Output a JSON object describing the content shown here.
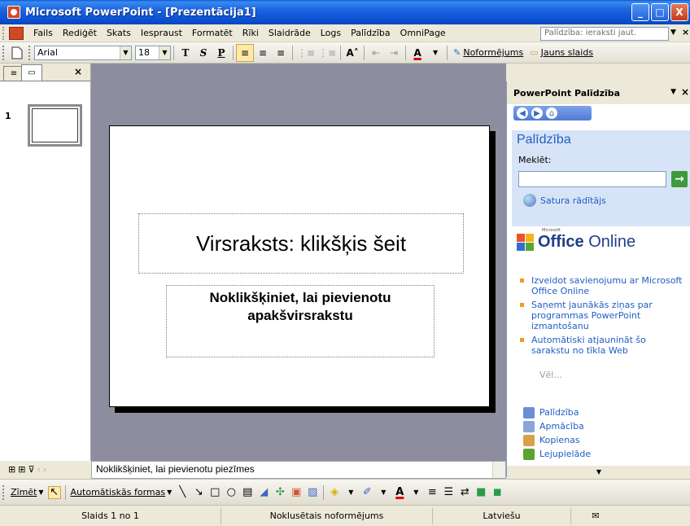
{
  "window": {
    "title": "Microsoft PowerPoint - [Prezentācija1]",
    "minimize_glyph": "_",
    "maximize_glyph": "□",
    "close_glyph": "X"
  },
  "menu": {
    "items": [
      "Fails",
      "Rediģēt",
      "Skats",
      "Iespraust",
      "Formatēt",
      "Rīki",
      "Slaidrāde",
      "Logs",
      "Palīdzība",
      "OmniPage"
    ],
    "help_placeholder": "Palīdzība: ieraksti jaut.",
    "close_glyph": "×"
  },
  "toolbar": {
    "font_name": "Arial",
    "font_size": "18",
    "bold": "T",
    "italic": "S",
    "underline": "P",
    "design_label": "Noformējums",
    "new_slide_label": "Jauns slaids"
  },
  "left_pane": {
    "tab_outline_glyph": "≡",
    "tab_slides_glyph": "▭",
    "close_glyph": "×",
    "slide_number": "1"
  },
  "slide": {
    "title_placeholder": "Virsraksts: klikšķis šeit",
    "subtitle_line1": "Noklikšķiniet, lai pievienotu",
    "subtitle_line2": "apakšvirsrakstu"
  },
  "notes": {
    "placeholder": "Noklikšķiniet, lai pievienotu piezīmes"
  },
  "task_pane": {
    "title": "PowerPoint Palīdzība",
    "heading": "Palīdzība",
    "search_label": "Meklēt:",
    "search_value": "",
    "toc_link": "Satura rādītājs",
    "office_small": "Microsoft",
    "office_word": "Office",
    "office_online": "Online",
    "bullets": [
      "Izveidot savienojumu ar Microsoft Office Online",
      "Saņemt jaunākās ziņas par programmas PowerPoint izmantošanu",
      "Automātiski atjaunināt šo sarakstu no tīkla Web"
    ],
    "more": "Vēl...",
    "links": [
      "Palīdzība",
      "Apmācība",
      "Kopienas",
      "Lejupielāde"
    ]
  },
  "drawing_toolbar": {
    "draw_label": "Zīmēt",
    "autoshapes_label": "Automātiskās formas"
  },
  "statusbar": {
    "slide_info": "Slaids 1 no 1",
    "design": "Noklusētais noformējums",
    "language": "Latviešu"
  },
  "colors": {
    "titlebar": "#0b4fd0",
    "accent_blue": "#215dc6",
    "slide_bg": "#8d8d9f",
    "bullet_orange": "#f09a28"
  }
}
